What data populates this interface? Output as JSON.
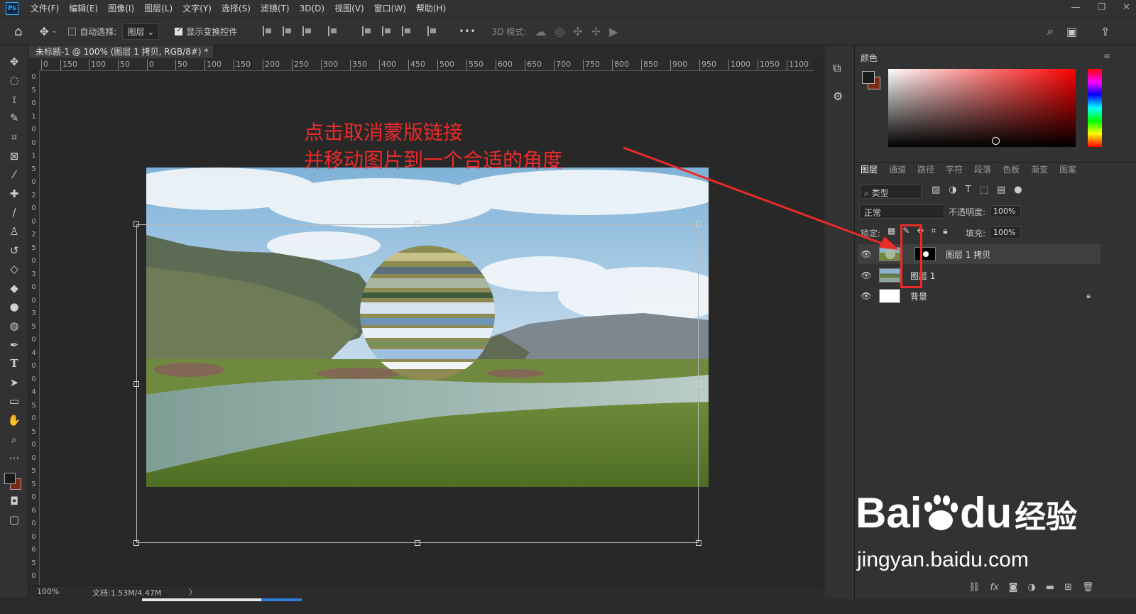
{
  "app": {
    "logo": "Ps"
  },
  "menu": [
    "文件(F)",
    "编辑(E)",
    "图像(I)",
    "图层(L)",
    "文字(Y)",
    "选择(S)",
    "滤镜(T)",
    "3D(D)",
    "视图(V)",
    "窗口(W)",
    "帮助(H)"
  ],
  "window_controls": {
    "minimize": "—",
    "restore": "❐",
    "close": "✕"
  },
  "options": {
    "auto_select_label": "自动选择:",
    "auto_select_target": "图层",
    "show_transform_label": "显示变换控件",
    "more": "•••",
    "mode_3d_label": "3D 模式:"
  },
  "document": {
    "tab_title": "未标题-1 @ 100% (图层 1 拷贝, RGB/8#) *",
    "tab_close": "×",
    "zoom": "100%",
    "doc_size": "文档:1.53M/4.47M",
    "status_arrow": "〉"
  },
  "ruler_top": [
    "0",
    "150",
    "100",
    "50",
    "0",
    "50",
    "100",
    "150",
    "200",
    "250",
    "300",
    "350",
    "400",
    "450",
    "500",
    "550",
    "600",
    "650",
    "700",
    "750",
    "800",
    "850",
    "900",
    "950",
    "1000",
    "1050",
    "1100"
  ],
  "ruler_left": [
    "0",
    "5",
    "0",
    "1",
    "0",
    "0",
    "1",
    "5",
    "0",
    "2",
    "0",
    "0",
    "2",
    "5",
    "0",
    "3",
    "0",
    "0",
    "3",
    "5",
    "0",
    "4",
    "0",
    "0",
    "4",
    "5",
    "0",
    "5",
    "0",
    "0",
    "5",
    "5",
    "0",
    "6",
    "0",
    "0",
    "6",
    "5",
    "0"
  ],
  "annotation": {
    "line1": "点击取消蒙版链接",
    "line2": "并移动图片到一个合适的角度"
  },
  "color_panel": {
    "title": "颜色",
    "fg": "#1a1a1a",
    "bg": "#7a2a12"
  },
  "layers_panel": {
    "tabs": [
      "图层",
      "通道",
      "路径",
      "字符",
      "段落",
      "色板",
      "渐变",
      "图案"
    ],
    "filter_label": "类型",
    "blend_mode": "正常",
    "opacity_label": "不透明度:",
    "opacity_value": "100%",
    "lock_label": "锁定:",
    "fill_label": "填充:",
    "fill_value": "100%",
    "layers": [
      {
        "name": "图层 1 拷贝"
      },
      {
        "name": "图层 1"
      },
      {
        "name": "背景"
      }
    ]
  },
  "watermark": {
    "brand": "Bai",
    "brand2": "du",
    "cn": "经验",
    "url": "jingyan.baidu.com"
  },
  "colors": {
    "annotation_red": "#ec2a2a",
    "ps_blue": "#31a8ff"
  }
}
